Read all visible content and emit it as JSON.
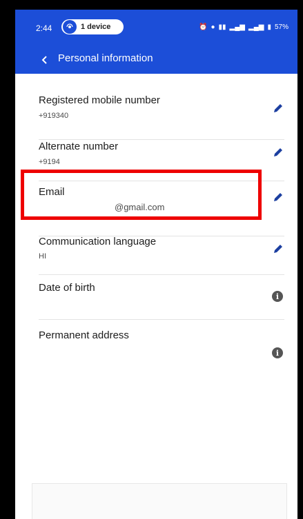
{
  "status_bar": {
    "time": "2:44",
    "device_pill": "1 device",
    "indicators": [
      "alarm",
      "location",
      "Vo LTE",
      "signal",
      "4G",
      "signal"
    ],
    "battery": "57%"
  },
  "header": {
    "title": "Personal information",
    "color": "#1c4ed8"
  },
  "fields": [
    {
      "label": "Registered mobile number",
      "value": "+919340",
      "action": "edit"
    },
    {
      "label": "Alternate number",
      "value": "+9194",
      "action": "edit"
    },
    {
      "label": "Email",
      "value": "@gmail.com",
      "action": "edit"
    },
    {
      "label": "Communication language",
      "value": "HI",
      "action": "edit"
    },
    {
      "label": "Date of birth",
      "value": "",
      "action": "info"
    },
    {
      "label": "Permanent address",
      "value": "",
      "action": "info"
    }
  ],
  "highlight_color": "#ee0000"
}
